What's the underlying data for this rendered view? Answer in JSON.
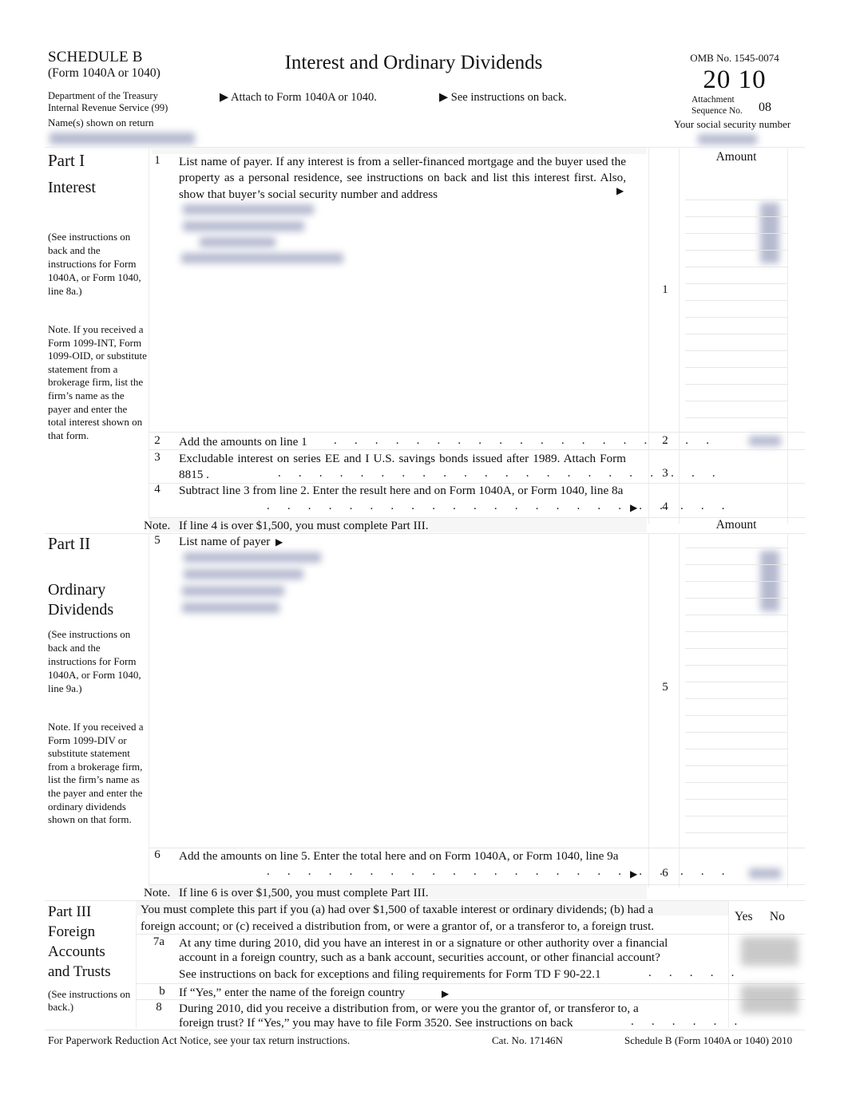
{
  "document": {
    "form_name": "SCHEDULE B",
    "form_sub": "(Form 1040A or 1040)",
    "department_line1": "Department of the Treasury",
    "department_line2": "Internal Revenue Service (99)",
    "name_shown_label": "Name(s) shown on return",
    "title": "Interest and Ordinary Dividends",
    "attach_note": "▶ Attach to Form 1040A or 1040.",
    "see_instructions_note": "▶ See instructions on back.",
    "omb": "OMB No. 1545-0074",
    "year": "20 10",
    "attachment_label_line1": "Attachment",
    "attachment_label_line2": "Sequence No.",
    "attachment_sequence_no": "08",
    "ssn_label": "Your social security number"
  },
  "part1": {
    "part_label": "Part I",
    "part_subtitle": "Interest",
    "note_instructions": "(See instructions on back and the instructions for Form 1040A, or Form 1040, line 8a.)",
    "note_1099": "Note.   If you received a Form 1099-INT, Form 1099-OID, or substitute statement from a brokerage firm, list the firm’s name as the payer and enter the total interest shown on that form.",
    "amount_header": "Amount",
    "lines": [
      {
        "number": "1",
        "text": "List name of payer. If any interest is from a seller-financed mortgage and the buyer used the property as a personal residence, see instructions on back and list this interest first. Also, show that buyer’s social security number and address",
        "arrow": "▶",
        "box_number": "1"
      },
      {
        "number": "2",
        "text": "Add the amounts on line 1",
        "box_number": "2"
      },
      {
        "number": "3",
        "text": "Excludable interest on series EE and I U.S. savings bonds issued after 1989. Attach Form 8815 .",
        "box_number": "3"
      },
      {
        "number": "4",
        "text": "Subtract line 3 from line 2. Enter the result here and on Form 1040A, or Form 1040, line 8a",
        "arrow": "▶",
        "box_number": "4"
      }
    ],
    "footer_note_label": "Note.",
    "footer_note": "If line 4 is over $1,500, you must complete Part III."
  },
  "part2": {
    "part_label": "Part II",
    "part_subtitle_line1": "Ordinary",
    "part_subtitle_line2": "Dividends",
    "note_instructions": "(See instructions on back and the instructions for Form 1040A, or Form 1040, line 9a.)",
    "note_1099": "Note.  If you received a Form 1099-DIV or substitute statement from a brokerage firm, list the firm’s name as the payer and enter the ordinary dividends shown on that form.",
    "amount_header": "Amount",
    "lines": [
      {
        "number": "5",
        "text": "List name of payer",
        "arrow": "▶",
        "box_number": "5"
      },
      {
        "number": "6",
        "text": "Add the amounts on line 5. Enter the total here and on Form 1040A, or Form 1040, line 9a",
        "arrow": "▶",
        "box_number": "6"
      }
    ],
    "footer_note_label": "Note.",
    "footer_note": "If line 6 is over $1,500, you must complete Part III."
  },
  "part3": {
    "part_label": "Part III",
    "part_subtitle_line1": "Foreign",
    "part_subtitle_line2": "Accounts",
    "part_subtitle_line3": "and Trusts",
    "note_instructions": "(See instructions on back.)",
    "intro_line1": "You must complete this part if you      (a) had over $1,500 of taxable interest or ordinary dividends;        (b) had a",
    "intro_line2": "foreign account; or    (c) received a distribution from, or were a grantor of, or a transferor to, a foreign trust.",
    "yes_label": "Yes",
    "no_label": "No",
    "lines": [
      {
        "number": "7a",
        "text_line1": "At any time during 2010, did you have an interest in or a signature or other authority over a financial",
        "text_line2": "account in a foreign country, such as a bank account, securities account, or other financial account?",
        "text_line3": "See instructions on back for exceptions and filing requirements for Form TD F 90-22.1"
      },
      {
        "number": "b",
        "text_line1": "If “Yes,” enter the name of the foreign country",
        "arrow": "▶"
      },
      {
        "number": "8",
        "text_line1": "During 2010, did you receive a distribution from, or were you the grantor of, or transferor to, a",
        "text_line2": "foreign trust? If “Yes,” you may have to file Form 3520. See instructions on back"
      }
    ]
  },
  "footer": {
    "paperwork": "For Paperwork Reduction Act Notice, see your tax return instructions.",
    "cat_no": "Cat. No. 17146N",
    "form_id": "Schedule B (Form 1040A or 1040) 2010"
  },
  "redactions": {
    "note": "Taxpayer-identifying values are blurred out in the source scan",
    "name_field": "redacted",
    "ssn_field": "redacted",
    "line1_payer_entries": "redacted",
    "line1_amount": "redacted",
    "line2_amount": "redacted",
    "line5_payer_entries": "redacted",
    "line5_amount": "redacted",
    "line6_amount": "redacted",
    "line7a_checkbox": "redacted",
    "line8_checkbox": "redacted"
  },
  "colors": {
    "page_background": "#ffffff",
    "text": "#111111",
    "redaction_blue": "#9aa0bd",
    "redaction_gray": "#9e9e9e",
    "rule": "#e7e7e7",
    "band": "#f6f6f6"
  }
}
